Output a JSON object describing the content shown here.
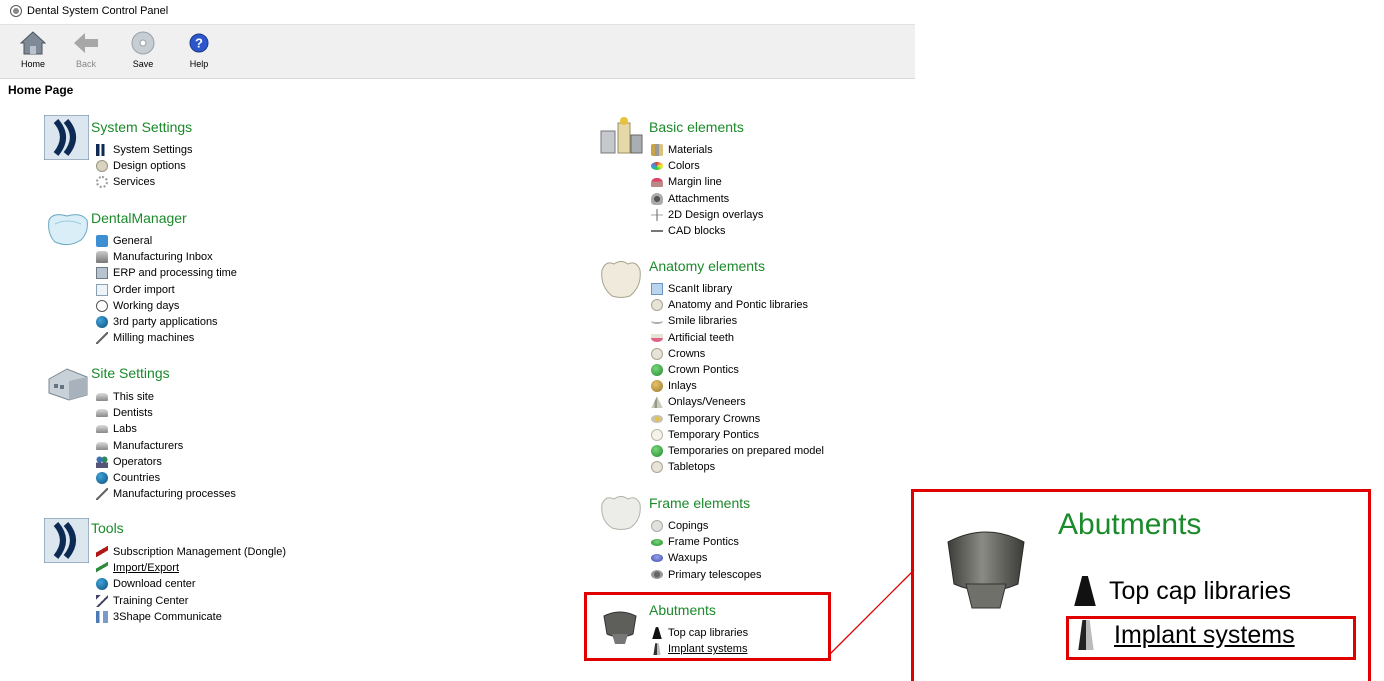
{
  "window": {
    "title": "Dental System Control Panel"
  },
  "toolbar": {
    "home": "Home",
    "back": "Back",
    "save": "Save",
    "help": "Help"
  },
  "page_title": "Home Page",
  "sections": {
    "system_settings": {
      "title": "System Settings",
      "items": [
        "System Settings",
        "Design options",
        "Services"
      ]
    },
    "dental_manager": {
      "title": "DentalManager",
      "items": [
        "General",
        "Manufacturing Inbox",
        "ERP and processing time",
        "Order import",
        "Working days",
        "3rd party applications",
        "Milling machines"
      ]
    },
    "site_settings": {
      "title": "Site Settings",
      "items": [
        "This site",
        "Dentists",
        "Labs",
        "Manufacturers",
        "Operators",
        "Countries",
        "Manufacturing processes"
      ]
    },
    "tools": {
      "title": "Tools",
      "items": [
        "Subscription Management (Dongle)",
        "Import/Export",
        "Download center",
        "Training Center",
        "3Shape Communicate"
      ]
    },
    "basic_elements": {
      "title": "Basic elements",
      "items": [
        "Materials",
        "Colors",
        "Margin line",
        "Attachments",
        "2D Design overlays",
        "CAD blocks"
      ]
    },
    "anatomy_elements": {
      "title": "Anatomy elements",
      "items": [
        "ScanIt library",
        "Anatomy and Pontic libraries",
        "Smile libraries",
        "Artificial teeth",
        "Crowns",
        "Crown Pontics",
        "Inlays",
        "Onlays/Veneers",
        "Temporary Crowns",
        "Temporary Pontics",
        "Temporaries on prepared model",
        "Tabletops"
      ]
    },
    "frame_elements": {
      "title": "Frame elements",
      "items": [
        "Copings",
        "Frame Pontics",
        "Waxups",
        "Primary telescopes"
      ]
    },
    "abutments": {
      "title": "Abutments",
      "items": [
        "Top cap libraries",
        "Implant systems"
      ]
    }
  },
  "colors": {
    "section_title": "#1a8a2a",
    "highlight": "#e00000",
    "toolbar_bg": "#f0f0f0"
  }
}
